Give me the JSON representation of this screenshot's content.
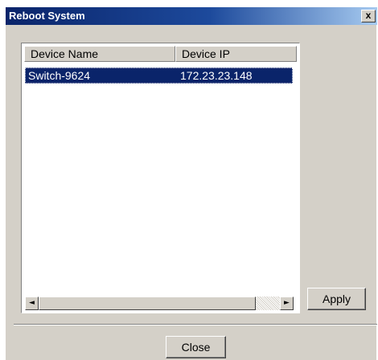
{
  "window": {
    "title": "Reboot System",
    "close_glyph": "x"
  },
  "table": {
    "columns": [
      "Device Name",
      "Device IP"
    ],
    "rows": [
      {
        "device_name": "Switch-9624",
        "device_ip": "172.23.23.148",
        "selected": true
      }
    ]
  },
  "scrollbar": {
    "left_arrow": "◄",
    "right_arrow": "►"
  },
  "buttons": {
    "apply": "Apply",
    "close": "Close"
  },
  "colors": {
    "titlebar": "#0a246a",
    "selection": "#0a246a",
    "face": "#d4d0c8"
  }
}
